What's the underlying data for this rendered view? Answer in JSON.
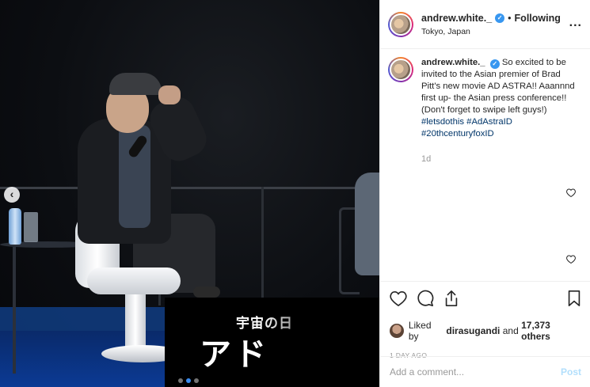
{
  "post": {
    "author": "andrew.white._",
    "follow_separator": "•",
    "follow_status": "Following",
    "location": "Tokyo, Japan",
    "more_label": "...",
    "verified_mark": "✓"
  },
  "caption": {
    "username": "andrew.white._",
    "text": "So excited to be invited to the Asian premier of Brad Pitt's new movie AD ASTRA!! Aaannnd first up- the Asian press conference!! (Don't forget to swipe left guys!)",
    "hashtags": [
      "#letsdothis",
      "#AdAstraID",
      "#20thcenturyfoxID"
    ],
    "time": "1d"
  },
  "photo": {
    "banner_line1": "宇宙の日",
    "banner_line2": "アド",
    "prev_arrow": "‹",
    "carousel_count": 3,
    "carousel_active": 2
  },
  "actions": {
    "liked_by_prefix": "Liked by",
    "liked_by_user": "dirasugandi",
    "and_label": "and",
    "others_count": "17,373 others",
    "timestamp": "1 DAY AGO"
  },
  "comment_box": {
    "placeholder": "Add a comment...",
    "post_label": "Post"
  },
  "colors": {
    "link": "#003569",
    "verified": "#3897f0",
    "post_button_disabled": "#b2dffc",
    "carousel_active": "#3a8cf0"
  },
  "icons": [
    "heart-icon",
    "comment-icon",
    "share-icon",
    "bookmark-icon",
    "more-icon",
    "verified-icon",
    "prev-arrow-icon"
  ]
}
